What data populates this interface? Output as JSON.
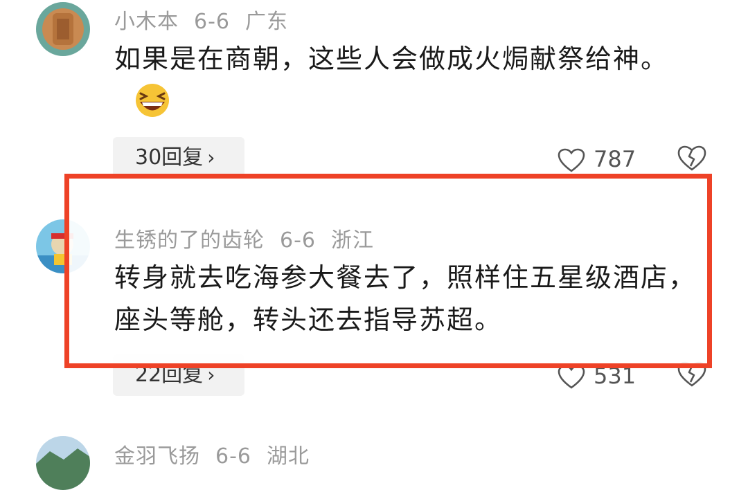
{
  "comments": [
    {
      "username": "小木本",
      "date": "6-6",
      "location": "广东",
      "text": "如果是在商朝，这些人会做成火焗献祭给神。",
      "replies": "30回复",
      "likes": "787",
      "emoji": "grinning-squinting-face"
    },
    {
      "username": "生锈的了的齿轮",
      "date": "6-6",
      "location": "浙江",
      "text": "转身就去吃海参大餐去了，照样住五星级酒店，座头等舱，转头还去指导苏超。",
      "replies": "22回复",
      "likes": "531"
    },
    {
      "username": "金羽飞扬",
      "date": "6-6",
      "location": "湖北"
    }
  ],
  "highlight_color": "#ee4227",
  "chevron": "›"
}
